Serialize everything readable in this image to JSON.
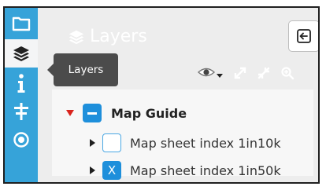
{
  "panel": {
    "title": "Layers"
  },
  "tooltip": {
    "text": "Layers"
  },
  "tree": {
    "group": {
      "label": "Map Guide",
      "expanded": true
    },
    "items": [
      {
        "label": "Map sheet index 1in10k",
        "checked": false
      },
      {
        "label": "Map sheet index 1in50k",
        "checked": true,
        "mark": "X"
      }
    ]
  },
  "rail": {
    "items": [
      "folder-icon",
      "layers-icon",
      "info-icon",
      "map-legend-icon",
      "location-icon"
    ],
    "active": "layers-icon"
  },
  "tools": [
    "visibility-menu-icon",
    "expand-all-icon",
    "collapse-all-icon",
    "zoom-to-layer-icon"
  ],
  "colors": {
    "rail": "#36a3d9",
    "accent": "#1e8fdb",
    "expanded_caret": "#d9231d",
    "tooltip": "#4b4b4b"
  }
}
